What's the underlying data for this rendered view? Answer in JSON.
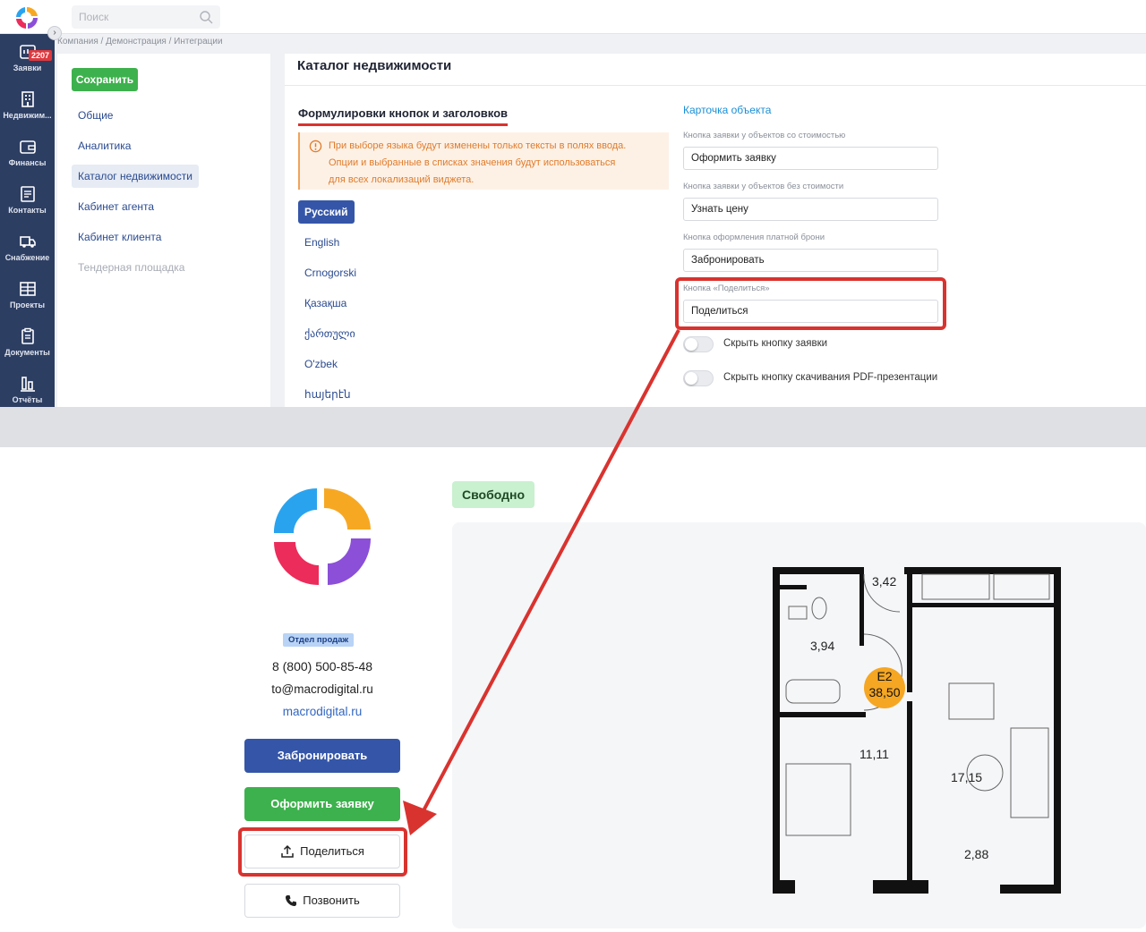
{
  "admin": {
    "search_placeholder": "Поиск",
    "breadcrumb": "Компания / Демонстрация / Интеграции",
    "nav": [
      {
        "label": "Заявки",
        "icon": "inbox-icon",
        "badge": "2207"
      },
      {
        "label": "Недвижим...",
        "icon": "building-icon"
      },
      {
        "label": "Финансы",
        "icon": "wallet-icon"
      },
      {
        "label": "Контакты",
        "icon": "contacts-icon"
      },
      {
        "label": "Снабжение",
        "icon": "truck-icon"
      },
      {
        "label": "Проекты",
        "icon": "projects-icon"
      },
      {
        "label": "Документы",
        "icon": "document-icon"
      },
      {
        "label": "Отчёты",
        "icon": "chart-icon"
      }
    ],
    "save_label": "Сохранить",
    "menu": [
      {
        "label": "Общие"
      },
      {
        "label": "Аналитика"
      },
      {
        "label": "Каталог недвижимости"
      },
      {
        "label": "Кабинет агента"
      },
      {
        "label": "Кабинет клиента"
      },
      {
        "label": "Тендерная площадка"
      }
    ],
    "page_title": "Каталог недвижимости",
    "section_title": "Формулировки кнопок и заголовков",
    "warning_lines": [
      "При выборе языка будут изменены только тексты в полях ввода.",
      "Опции и выбранные в списках значения будут использоваться",
      "для всех локализаций виджета."
    ],
    "languages": [
      {
        "label": "Русский"
      },
      {
        "label": "English"
      },
      {
        "label": "Crnogorski"
      },
      {
        "label": "Қазақша"
      },
      {
        "label": "ქართული"
      },
      {
        "label": "O'zbek"
      },
      {
        "label": "հայերէն"
      }
    ],
    "card_title": "Карточка объекта",
    "fields": [
      {
        "label": "Кнопка заявки у объектов со стоимостью",
        "value": "Оформить заявку"
      },
      {
        "label": "Кнопка заявки у объектов без стоимости",
        "value": "Узнать цену"
      },
      {
        "label": "Кнопка оформления платной брони",
        "value": "Забронировать"
      },
      {
        "label": "Кнопка «Поделиться»",
        "value": "Поделиться"
      }
    ],
    "toggles": [
      {
        "label": "Скрыть кнопку заявки",
        "on": false
      },
      {
        "label": "Скрыть кнопку скачивания PDF-презентации",
        "on": false
      }
    ]
  },
  "widget": {
    "department": "Отдел продаж",
    "phone": "8 (800) 500-85-48",
    "email": "to@macrodigital.ru",
    "site": "macrodigital.ru",
    "book_label": "Забронировать",
    "apply_label": "Оформить заявку",
    "share_label": "Поделиться",
    "call_label": "Позвонить",
    "status": "Свободно",
    "plan": {
      "unit_label": "E2",
      "unit_area": "38,50",
      "rooms": [
        "3,42",
        "3,94",
        "11,11",
        "17,15",
        "2,88"
      ]
    }
  },
  "colors": {
    "nav_bg": "#2d3e63",
    "primary": "#3556a8",
    "success": "#3db14d",
    "highlight": "#d9332f",
    "link": "#1b8fd6",
    "badge": "#f5a623"
  }
}
